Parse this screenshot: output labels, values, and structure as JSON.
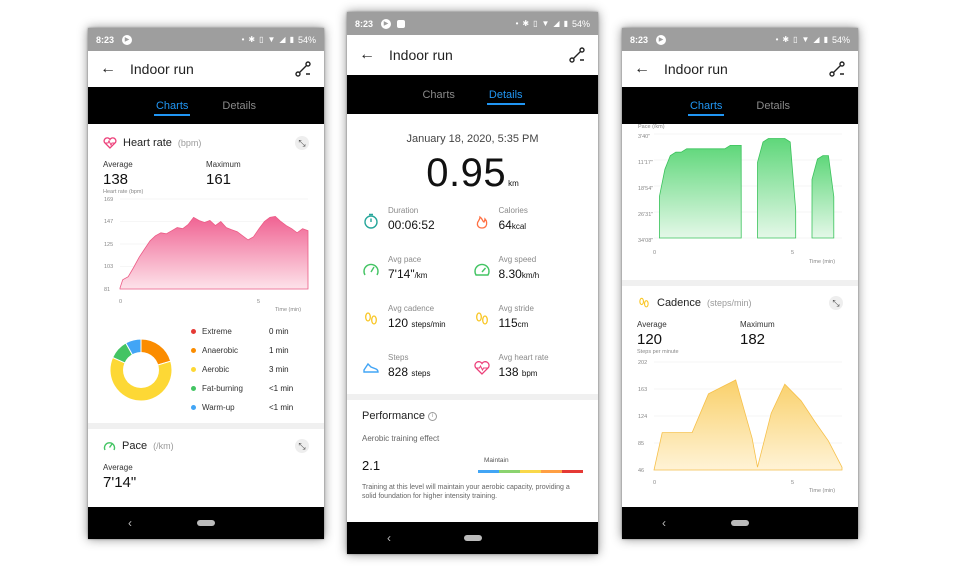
{
  "status": {
    "time": "8:23",
    "battery": "54%"
  },
  "app": {
    "title": "Indoor run",
    "back_glyph": "←"
  },
  "tabs": {
    "charts": "Charts",
    "details": "Details"
  },
  "heart_rate": {
    "title": "Heart rate",
    "unit": "(bpm)",
    "average_label": "Average",
    "average": "138",
    "maximum_label": "Maximum",
    "maximum": "161",
    "axis_title": "Heart rate (bpm)",
    "y_ticks": [
      "169",
      "147",
      "125",
      "103",
      "81"
    ],
    "x_ticks": [
      "0",
      "5"
    ],
    "x_title": "Time (min)",
    "zones": [
      {
        "name": "Extreme",
        "value": "0 min",
        "color": "#e53935"
      },
      {
        "name": "Anaerobic",
        "value": "1 min",
        "color": "#fb8c00"
      },
      {
        "name": "Aerobic",
        "value": "3 min",
        "color": "#fdd835"
      },
      {
        "name": "Fat-burning",
        "value": "<1 min",
        "color": "#43c463"
      },
      {
        "name": "Warm-up",
        "value": "<1 min",
        "color": "#42a5f5"
      }
    ]
  },
  "pace_card": {
    "title": "Pace",
    "unit": "(/km)",
    "average_label": "Average",
    "average": "7'14\""
  },
  "details": {
    "date": "January 18, 2020, 5:35 PM",
    "distance": "0.95",
    "distance_unit": "km",
    "metrics": [
      {
        "label": "Duration",
        "value": "00:06:52",
        "unit": "",
        "icon": "stopwatch-icon",
        "color": "#26a69a"
      },
      {
        "label": "Calories",
        "value": "64",
        "unit": "kcal",
        "icon": "flame-icon",
        "color": "#ff7043"
      },
      {
        "label": "Avg pace",
        "value": "7'14\"",
        "unit": "/km",
        "icon": "gauge-icon",
        "color": "#43c463"
      },
      {
        "label": "Avg speed",
        "value": "8.30",
        "unit": "km/h",
        "icon": "speedometer-icon",
        "color": "#43c463"
      },
      {
        "label": "Avg cadence",
        "value": "120",
        "unit": "steps/min",
        "icon": "footprints-icon",
        "color": "#f9c623"
      },
      {
        "label": "Avg stride",
        "value": "115",
        "unit": "cm",
        "icon": "footprints-icon",
        "color": "#f9c623"
      },
      {
        "label": "Steps",
        "value": "828",
        "unit": "steps",
        "icon": "shoe-icon",
        "color": "#42a5f5"
      },
      {
        "label": "Avg heart rate",
        "value": "138",
        "unit": "bpm",
        "icon": "heart-icon",
        "color": "#ec407a"
      }
    ],
    "performance_title": "Performance",
    "aerobic_label": "Aerobic training effect",
    "aerobic_value": "2.1",
    "maintain_label": "Maintain",
    "description": "Training at this level will maintain your aerobic capacity, providing a solid foundation for higher intensity training."
  },
  "pace_chart": {
    "axis_title": "Pace (/km)",
    "y_ticks": [
      "3'40\"",
      "11'17\"",
      "18'54\"",
      "26'31\"",
      "34'08\""
    ],
    "x_ticks": [
      "0",
      "5"
    ],
    "x_title": "Time (min)"
  },
  "cadence": {
    "title": "Cadence",
    "unit": "(steps/min)",
    "average_label": "Average",
    "average": "120",
    "maximum_label": "Maximum",
    "maximum": "182",
    "axis_title": "Steps per minute",
    "y_ticks": [
      "202",
      "163",
      "124",
      "85",
      "46"
    ],
    "x_ticks": [
      "0",
      "5"
    ],
    "x_title": "Time (min)"
  },
  "chart_data": [
    {
      "type": "area",
      "title": "Heart rate",
      "ylabel": "Heart rate (bpm)",
      "xlabel": "Time (min)",
      "ylim": [
        81,
        169
      ],
      "xlim": [
        0,
        6.9
      ],
      "x": [
        0.0,
        0.1,
        0.3,
        0.5,
        0.7,
        0.9,
        1.1,
        1.3,
        1.5,
        1.7,
        1.9,
        2.1,
        2.3,
        2.5,
        2.7,
        2.9,
        3.1,
        3.3,
        3.5,
        3.7,
        3.9,
        4.1,
        4.3,
        4.5,
        4.7,
        4.9,
        5.1,
        5.3,
        5.5,
        5.7,
        5.9,
        6.1,
        6.3,
        6.5,
        6.7,
        6.9
      ],
      "y": [
        82,
        90,
        93,
        102,
        112,
        120,
        128,
        133,
        136,
        135,
        138,
        141,
        140,
        144,
        151,
        148,
        146,
        148,
        143,
        147,
        141,
        139,
        137,
        133,
        129,
        132,
        140,
        147,
        151,
        152,
        147,
        143,
        140,
        136,
        140,
        138
      ]
    },
    {
      "type": "pie",
      "title": "Heart rate zones",
      "categories": [
        "Extreme",
        "Anaerobic",
        "Aerobic",
        "Fat-burning",
        "Warm-up"
      ],
      "values": [
        0,
        1,
        3,
        0.5,
        0.4
      ]
    },
    {
      "type": "area",
      "title": "Pace",
      "ylabel": "Pace (/km)",
      "xlabel": "Time (min)",
      "x": [
        0.0,
        0.2,
        0.4,
        0.6,
        0.8,
        1.0,
        1.2,
        1.4,
        1.6,
        1.8,
        2.0,
        2.2,
        2.4,
        2.6,
        2.8,
        3.0,
        3.2,
        3.4,
        3.5,
        3.6,
        3.8,
        4.0,
        4.2,
        4.4,
        4.6,
        4.8,
        5.0,
        5.2,
        5.4,
        5.5,
        5.6,
        5.8,
        6.0,
        6.2,
        6.4,
        6.6,
        6.8
      ],
      "y": [
        null,
        22,
        14,
        10,
        9,
        9,
        8,
        8,
        8,
        8,
        8,
        8,
        8,
        8,
        7,
        7,
        7,
        null,
        null,
        null,
        12,
        6,
        5,
        5,
        5,
        5,
        6,
        26,
        null,
        null,
        null,
        17,
        11,
        10,
        10,
        22,
        null
      ]
    },
    {
      "type": "area",
      "title": "Cadence",
      "ylabel": "Steps per minute",
      "xlabel": "Time (min)",
      "ylim": [
        46,
        202
      ],
      "xlim": [
        0,
        6.9
      ],
      "x": [
        0.0,
        0.3,
        0.8,
        1.4,
        2.0,
        2.6,
        3.0,
        3.6,
        3.8,
        4.3,
        4.8,
        5.4,
        5.9,
        6.4,
        6.9
      ],
      "y": [
        46,
        100,
        100,
        100,
        156,
        168,
        176,
        92,
        50,
        128,
        170,
        146,
        116,
        88,
        50
      ]
    }
  ]
}
